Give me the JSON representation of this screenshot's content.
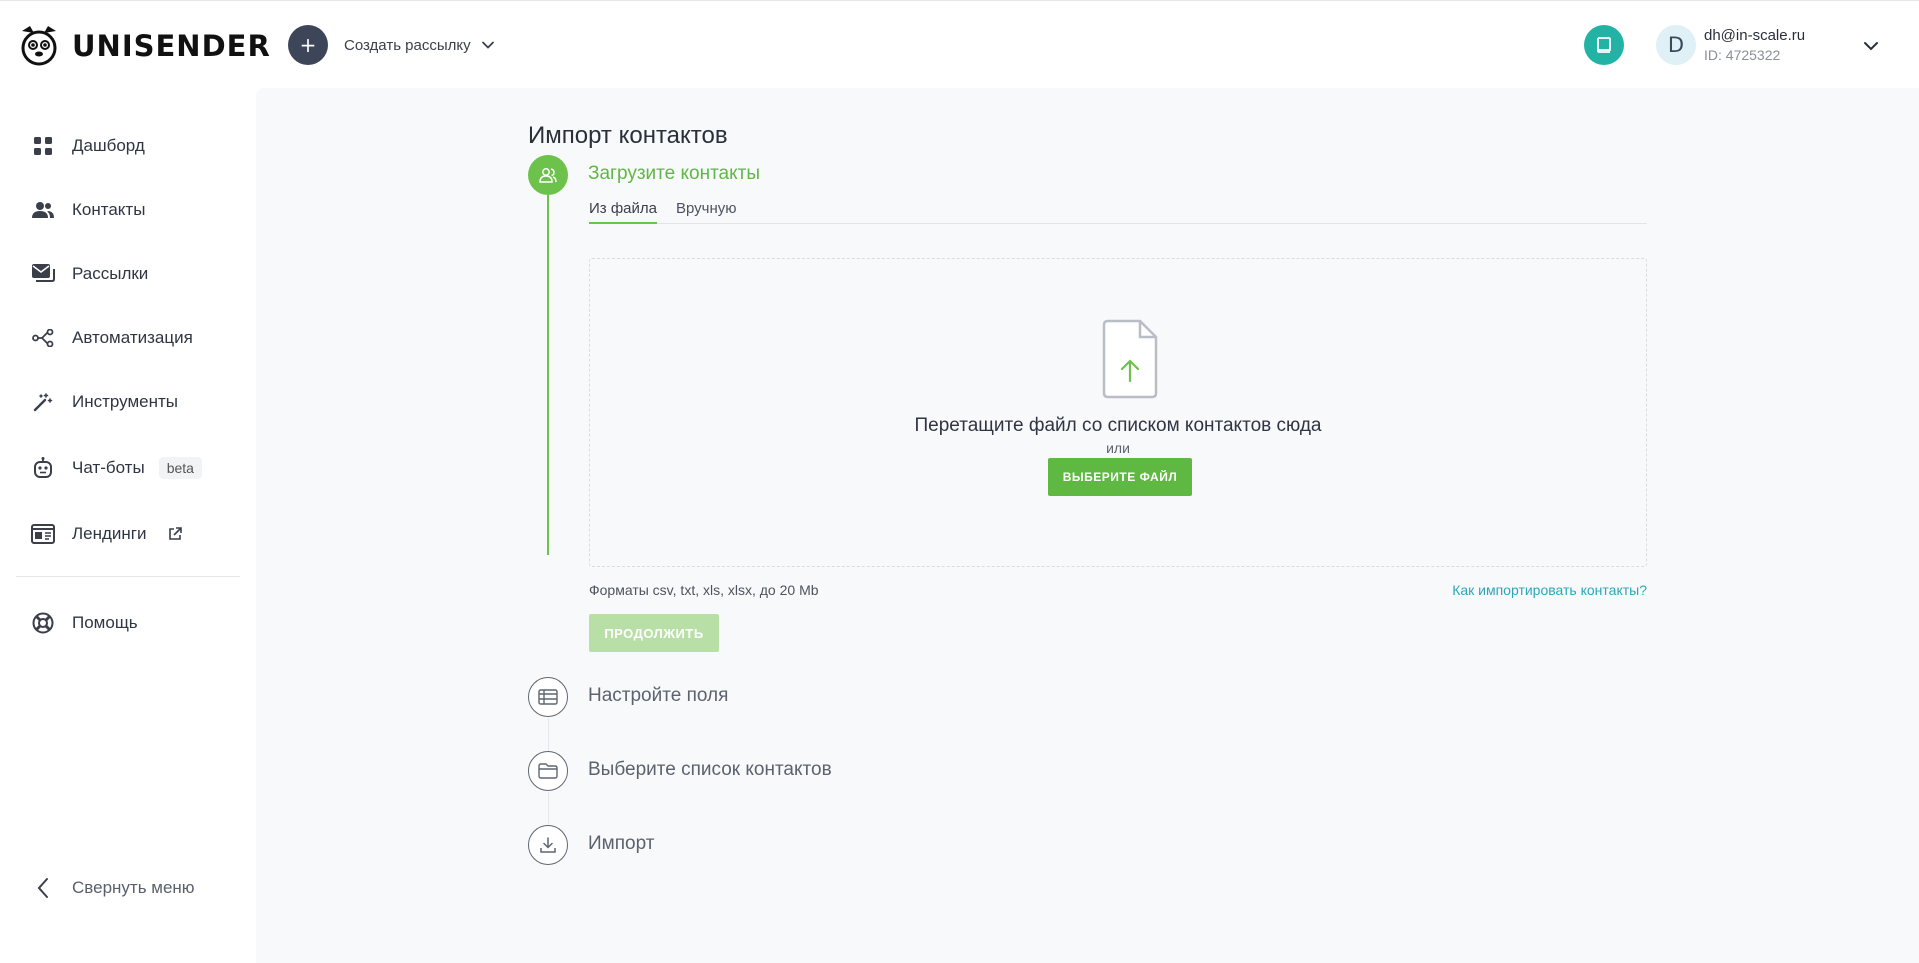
{
  "header": {
    "brand": "UNISENDER",
    "create_label": "Создать рассылку",
    "create_plus": "+",
    "user_initial": "D",
    "user_email": "dh@in-scale.ru",
    "user_id": "ID: 4725322"
  },
  "sidebar": {
    "items": [
      {
        "label": "Дашборд",
        "icon": "dashboard-icon"
      },
      {
        "label": "Контакты",
        "icon": "contacts-icon"
      },
      {
        "label": "Рассылки",
        "icon": "mailings-icon"
      },
      {
        "label": "Автоматизация",
        "icon": "automation-icon"
      },
      {
        "label": "Инструменты",
        "icon": "tools-icon"
      },
      {
        "label": "Чат-боты",
        "icon": "chatbot-icon",
        "badge": "beta"
      },
      {
        "label": "Лендинги",
        "icon": "landing-icon",
        "external": true
      },
      {
        "label": "Помощь",
        "icon": "help-icon"
      }
    ],
    "collapse_label": "Свернуть меню"
  },
  "main": {
    "title": "Импорт контактов",
    "steps": [
      {
        "title": "Загрузите контакты",
        "state": "active"
      },
      {
        "title": "Настройте поля",
        "state": "inactive"
      },
      {
        "title": "Выберите список контактов",
        "state": "inactive"
      },
      {
        "title": "Импорт",
        "state": "inactive"
      }
    ],
    "tabs": [
      {
        "label": "Из файла",
        "active": true
      },
      {
        "label": "Вручную",
        "active": false
      }
    ],
    "dropzone": {
      "text": "Перетащите файл со списком контактов сюда",
      "or": "или",
      "button": "ВЫБЕРИТЕ ФАЙЛ"
    },
    "formats": "Форматы csv, txt, xls, xlsx, до 20 Mb",
    "howto_link": "Как импортировать контакты?",
    "continue_button": "ПРОДОЛЖИТЬ"
  },
  "colors": {
    "accent_green": "#6cc24a",
    "link_teal": "#2aa8b8",
    "dark_button": "#3d4558"
  }
}
